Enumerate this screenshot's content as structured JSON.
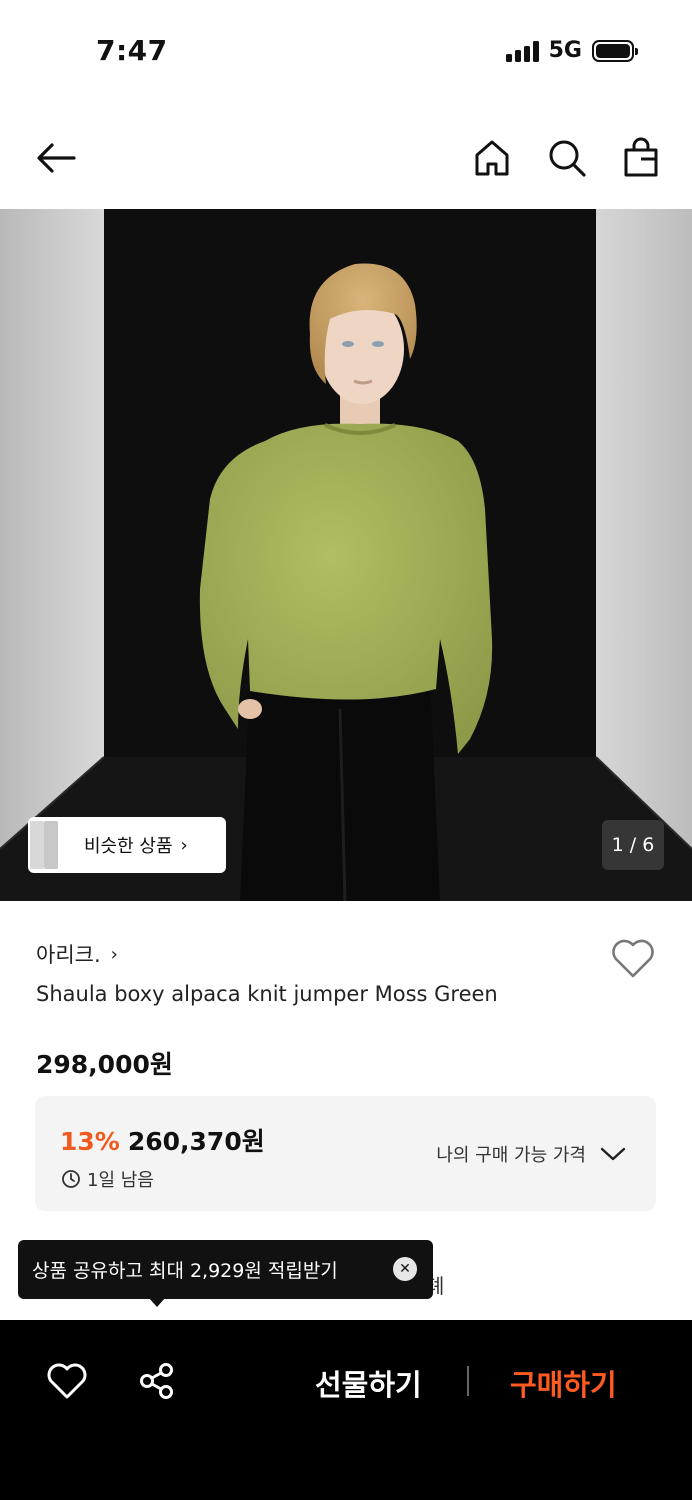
{
  "status_bar": {
    "time": "7:47",
    "network": "5G",
    "battery_level": 1.0
  },
  "nav": {
    "icons": [
      "back-arrow-icon",
      "home-icon",
      "search-icon",
      "shopping-bag-icon"
    ]
  },
  "gallery": {
    "similar_label": "비슷한 상품",
    "page_counter": "1 / 6",
    "current_page": 1,
    "total_pages": 6
  },
  "product": {
    "brand": "아리크.",
    "name": "Shaula boxy alpaca knit jumper Moss Green",
    "original_price": "298,000원",
    "discount_rate": "13%",
    "discount_price": "260,370원",
    "time_left": "1일 남음",
    "my_price_label": "나의 구매 가능 가격"
  },
  "peek_text": "톄",
  "tooltip": {
    "text": "상품 공유하고 최대 2,929원 적립받기"
  },
  "bottom_bar": {
    "gift_label": "선물하기",
    "buy_label": "구매하기"
  },
  "colors": {
    "accent": "#f05a1e",
    "buy": "#ff5a1f",
    "sweater": "#a6b158",
    "backdrop": "#0e0e0e"
  }
}
